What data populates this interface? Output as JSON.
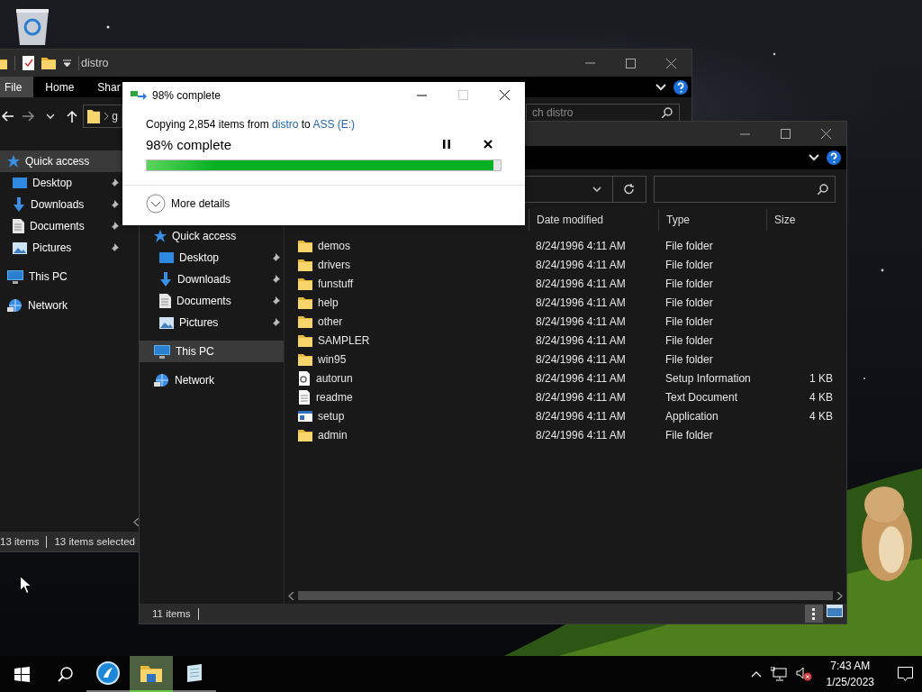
{
  "back_window": {
    "title": "distro",
    "ribbon_tabs": [
      {
        "label": "File",
        "selected": true
      },
      {
        "label": "Home",
        "selected": false
      },
      {
        "label": "Shar",
        "selected": false
      }
    ],
    "address": "g",
    "search": {
      "placeholder": "ch distro"
    },
    "nav": [
      {
        "label": "Quick access",
        "kind": "star",
        "selected": true,
        "pinned": false,
        "children": [
          {
            "label": "Desktop",
            "kind": "desktop",
            "selected": false,
            "pinned": true
          },
          {
            "label": "Downloads",
            "kind": "downloads",
            "selected": false,
            "pinned": true
          },
          {
            "label": "Documents",
            "kind": "documents",
            "selected": false,
            "pinned": true
          },
          {
            "label": "Pictures",
            "kind": "pictures",
            "selected": false,
            "pinned": true
          }
        ]
      },
      {
        "label": "This PC",
        "kind": "pc",
        "selected": false,
        "pinned": false
      },
      {
        "label": "Network",
        "kind": "network",
        "selected": false,
        "pinned": false
      }
    ],
    "status": [
      "13 items",
      "13 items selected"
    ]
  },
  "front_window": {
    "nav": [
      {
        "label": "Quick access",
        "kind": "star",
        "selected": false,
        "pinned": false,
        "children": [
          {
            "label": "Desktop",
            "kind": "desktop",
            "selected": false,
            "pinned": true
          },
          {
            "label": "Downloads",
            "kind": "downloads",
            "selected": false,
            "pinned": true
          },
          {
            "label": "Documents",
            "kind": "documents",
            "selected": false,
            "pinned": true
          },
          {
            "label": "Pictures",
            "kind": "pictures",
            "selected": false,
            "pinned": true
          }
        ]
      },
      {
        "label": "This PC",
        "kind": "pc",
        "selected": true,
        "pinned": false
      },
      {
        "label": "Network",
        "kind": "network",
        "selected": false,
        "pinned": false
      }
    ],
    "columns": [
      "Date modified",
      "Type",
      "Size"
    ],
    "rows": [
      {
        "name": "demos",
        "date": "8/24/1996 4:11 AM",
        "type": "File folder",
        "kind": "folder"
      },
      {
        "name": "drivers",
        "date": "8/24/1996 4:11 AM",
        "type": "File folder",
        "kind": "folder"
      },
      {
        "name": "funstuff",
        "date": "8/24/1996 4:11 AM",
        "type": "File folder",
        "kind": "folder"
      },
      {
        "name": "help",
        "date": "8/24/1996 4:11 AM",
        "type": "File folder",
        "kind": "folder"
      },
      {
        "name": "other",
        "date": "8/24/1996 4:11 AM",
        "type": "File folder",
        "kind": "folder"
      },
      {
        "name": "SAMPLER",
        "date": "8/24/1996 4:11 AM",
        "type": "File folder",
        "kind": "folder"
      },
      {
        "name": "win95",
        "date": "8/24/1996 4:11 AM",
        "type": "File folder",
        "kind": "folder"
      },
      {
        "name": "autorun",
        "date": "8/24/1996 4:11 AM",
        "type": "Setup Information",
        "size": "1 KB",
        "kind": "settings"
      },
      {
        "name": "readme",
        "date": "8/24/1996 4:11 AM",
        "type": "Text Document",
        "size": "4 KB",
        "kind": "text"
      },
      {
        "name": "setup",
        "date": "8/24/1996 4:11 AM",
        "type": "Application",
        "size": "4 KB",
        "kind": "app"
      },
      {
        "name": "admin",
        "date": "8/24/1996 4:11 AM",
        "type": "File folder",
        "kind": "folder"
      }
    ],
    "status": "11 items"
  },
  "copy_dialog": {
    "title": "98% complete",
    "message": [
      {
        "kind": "text",
        "text": "Copying 2,854 items from "
      },
      {
        "kind": "link",
        "text": "distro"
      },
      {
        "kind": "text",
        "text": " to "
      },
      {
        "kind": "link",
        "text": "ASS (E:)"
      }
    ],
    "status": "98% complete",
    "level": 0.98,
    "maximize_disabled": true,
    "more_details": "More details"
  },
  "taskbar": {
    "apps": [
      {
        "kind": "browser",
        "active": false
      },
      {
        "kind": "explorer",
        "active": true
      },
      {
        "kind": "notepad",
        "active": false
      }
    ],
    "volume_muted": true,
    "time": "7:43 AM",
    "date": "1/25/2023"
  }
}
